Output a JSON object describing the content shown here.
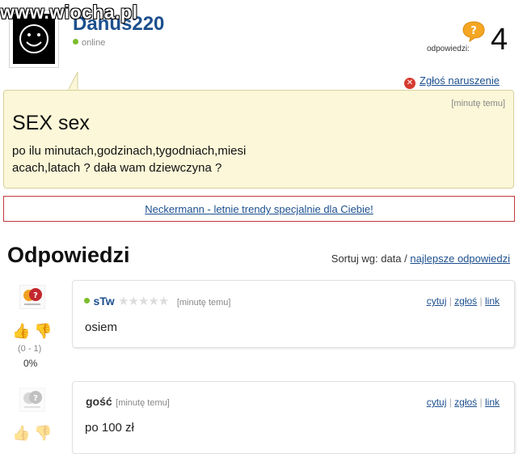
{
  "watermark": "www.wiocha.pl",
  "user": {
    "name": "Danus220",
    "status": "online"
  },
  "question_stats": {
    "answers_label": "odpowiedzi:",
    "answers_count": "4"
  },
  "report_label": "Zgłoś naruszenie",
  "question": {
    "time": "[minutę temu]",
    "title": "SEX sex",
    "body_line1": "po ilu minutach,godzinach,tygodniach,miesi",
    "body_line2": "acach,latach ? dała wam dziewczyna ?"
  },
  "ad": {
    "text": "Neckermann - letnie trendy specjalnie dla Ciebie!"
  },
  "answers_section": {
    "heading": "Odpowiedzi",
    "sort_label": "Sortuj wg:",
    "sort_current": "data",
    "sort_separator": "/",
    "sort_best": "najlepsze odpowiedzi"
  },
  "answers": [
    {
      "author": "sTw",
      "stars": "★★★★★",
      "time": "[minutę temu]",
      "text": "osiem",
      "actions": [
        "cytuj",
        "zgłoś",
        "link"
      ],
      "vote_range": "(0 - 1)",
      "vote_pct": "0%"
    },
    {
      "author": "gość",
      "time": "[minutę temu]",
      "text": "po 100 zł",
      "actions": [
        "cytuj",
        "zgłoś",
        "link"
      ]
    }
  ],
  "colors": {
    "link": "#1c4f8e",
    "question_bg": "#fbf7d8",
    "ad_border": "#c0393b",
    "online": "#7bbd2c",
    "report": "#d63b2f"
  }
}
